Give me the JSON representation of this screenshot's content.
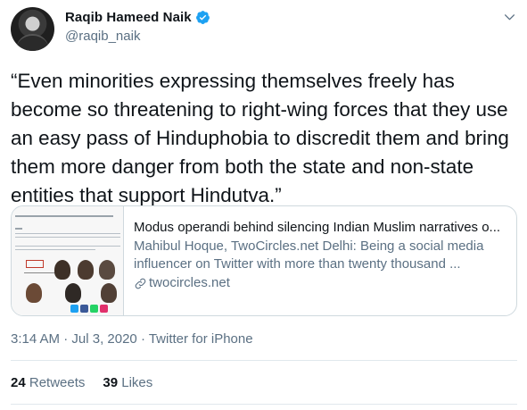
{
  "author": {
    "display_name": "Raqib Hameed Naik",
    "handle": "@raqib_naik",
    "verified": true
  },
  "tweet": {
    "text": "“Even minorities expressing themselves freely has become so threatening to right-wing forces that they use an easy pass of Hinduphobia to discredit them and bring them more danger from both the state and non-state entities that support Hindutva.”"
  },
  "card": {
    "title": "Modus operandi behind silencing Indian Muslim narratives o...",
    "description": "Mahibul Hoque, TwoCircles.net  Delhi: Being a social media influencer on Twitter with more than twenty thousand ...",
    "domain": "twocircles.net"
  },
  "meta": {
    "time": "3:14 AM",
    "separator": " · ",
    "date": "Jul 3, 2020",
    "source": "Twitter for iPhone"
  },
  "stats": {
    "retweets_count": "24",
    "retweets_label": "Retweets",
    "likes_count": "39",
    "likes_label": "Likes"
  },
  "icons": {
    "verified": "verified-badge-icon",
    "caret": "chevron-down-icon",
    "link": "link-icon"
  },
  "colors": {
    "verified_blue": "#1da1f2",
    "secondary_text": "#5b7083",
    "border": "#cfd9de"
  }
}
